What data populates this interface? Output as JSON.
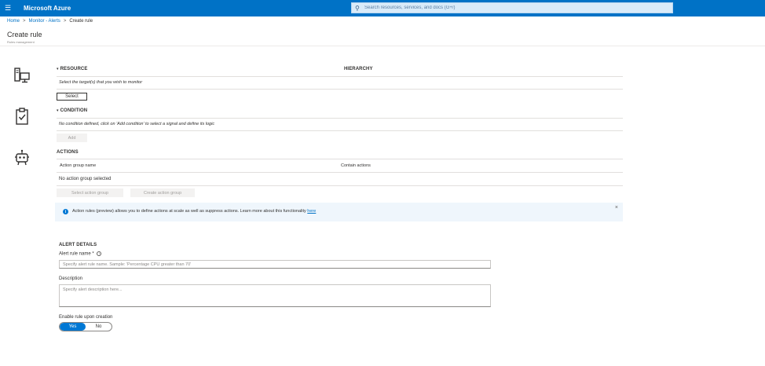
{
  "topbar": {
    "menu_icon": "hamburger-icon",
    "brand": "Microsoft Azure",
    "search_placeholder": "Search resources, services, and docs (G+/)",
    "search_icon": "search-icon"
  },
  "breadcrumb": {
    "items": [
      "Home",
      "Monitor - Alerts",
      "Create rule"
    ],
    "separator": ">"
  },
  "page": {
    "title": "Create rule",
    "subtitle": "Rules management"
  },
  "resource": {
    "header": "RESOURCE",
    "hierarchy_header": "HIERARCHY",
    "hint": "Select the target(s) that you wish to monitor",
    "select_button": "Select",
    "icon": "resource-computer-icon"
  },
  "condition": {
    "header": "CONDITION",
    "hint": "No condition defined, click on 'Add condition' to select a signal and define its logic",
    "add_button": "Add",
    "icon": "condition-clipboard-icon"
  },
  "actions": {
    "header": "ACTIONS",
    "columns": [
      "Action group name",
      "Contain actions"
    ],
    "empty_text": "No action group selected",
    "select_button": "Select action group",
    "create_button": "Create action group",
    "icon": "actions-robot-icon"
  },
  "banner": {
    "text": "Action rules (preview) allows you to define actions at scale as well as suppress actions. Learn more about this functionality",
    "link": "here",
    "close": "×",
    "icon": "info-icon"
  },
  "alert_details": {
    "header": "ALERT DETAILS",
    "name_label": "Alert rule name",
    "required_mark": "*",
    "name_placeholder": "Specify alert rule name. Sample: 'Percentage CPU greater than 70'",
    "description_label": "Description",
    "description_placeholder": "Specify alert description here...",
    "enable_label": "Enable rule upon creation",
    "toggle": {
      "on_label": "Yes",
      "off_label": "No",
      "selected": "Yes"
    }
  },
  "colors": {
    "topbar": "#0072c6",
    "link": "#0072c6",
    "toggle_on": "#0078d4",
    "banner_bg": "#eff6fc"
  }
}
